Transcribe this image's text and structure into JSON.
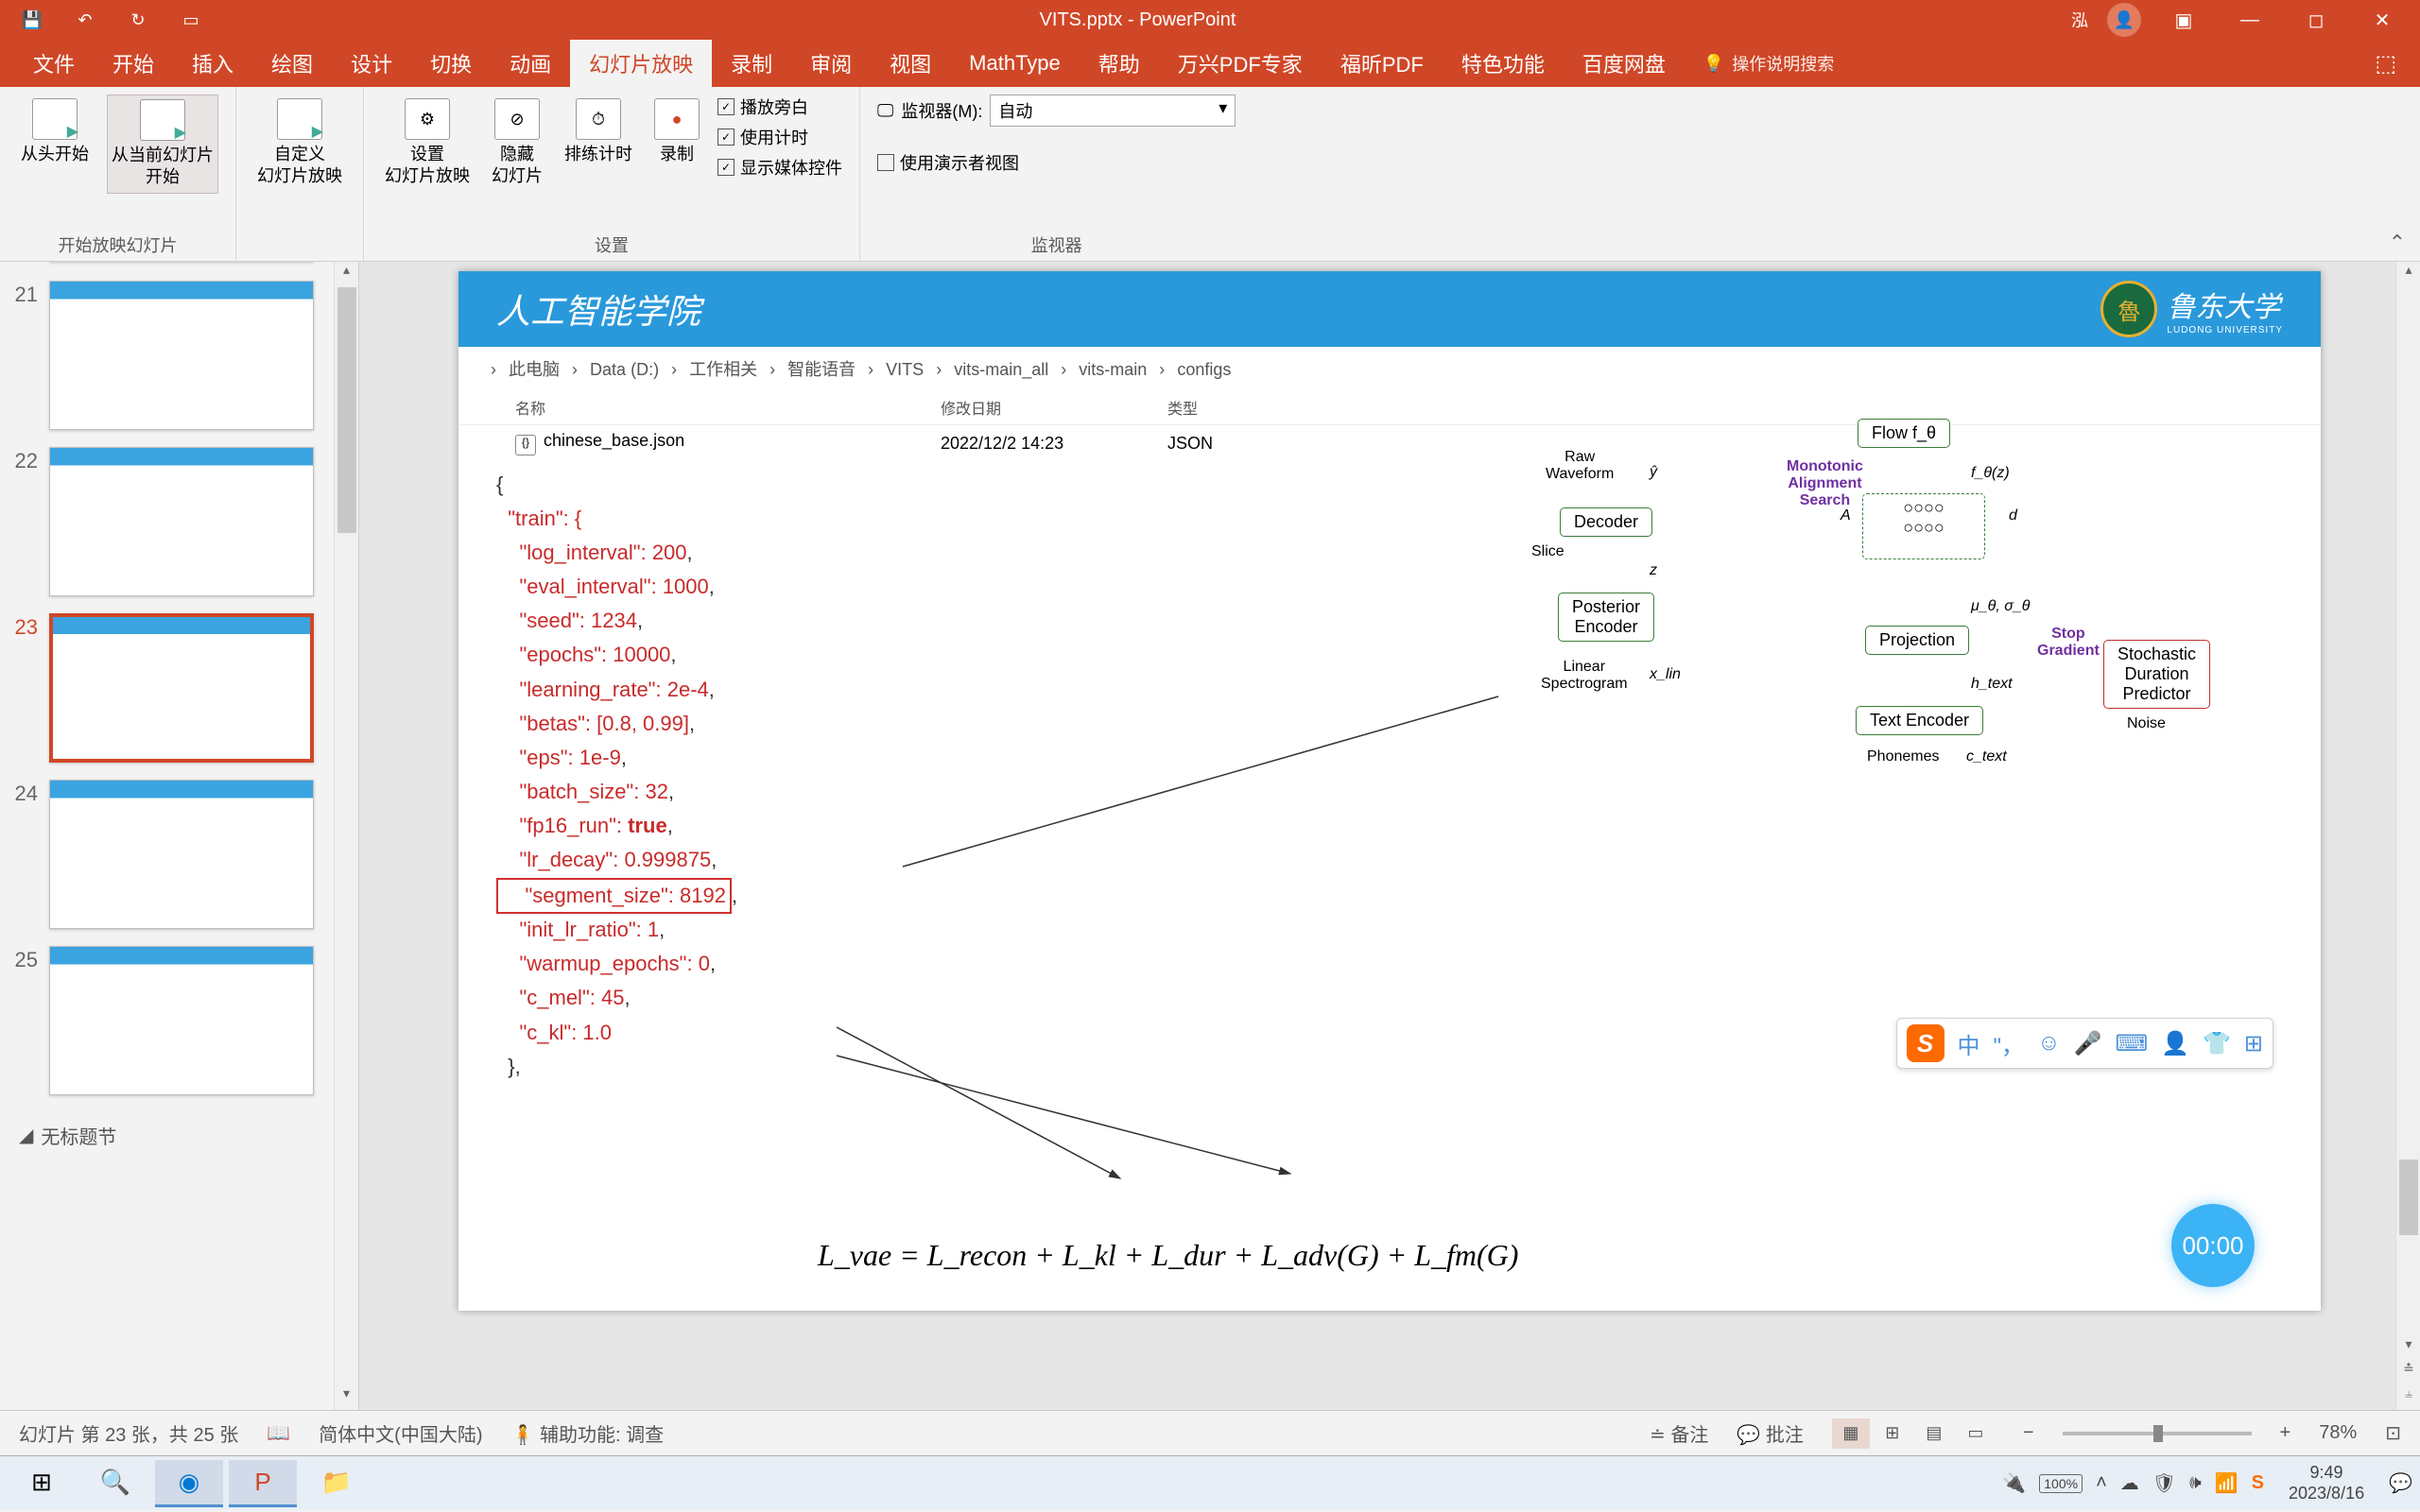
{
  "title_bar": {
    "doc_title": "VITS.pptx - PowerPoint",
    "user_name": "泓"
  },
  "ribbon_tabs": [
    "文件",
    "开始",
    "插入",
    "绘图",
    "设计",
    "切换",
    "动画",
    "幻灯片放映",
    "录制",
    "审阅",
    "视图",
    "MathType",
    "帮助",
    "万兴PDF专家",
    "福昕PDF",
    "特色功能",
    "百度网盘"
  ],
  "active_tab_index": 7,
  "tell_me_placeholder": "操作说明搜索",
  "ribbon": {
    "group1": {
      "btn1": "从头开始",
      "btn2": "从当前幻灯片\n开始",
      "label": "开始放映幻灯片"
    },
    "group1b": {
      "btn": "自定义\n幻灯片放映",
      "dropdown": "▾"
    },
    "group2": {
      "btn1": "设置\n幻灯片放映",
      "btn2": "隐藏\n幻灯片",
      "btn3": "排练计时",
      "btn4": "录制",
      "chk1": "播放旁白",
      "chk2": "使用计时",
      "chk3": "显示媒体控件",
      "label": "设置"
    },
    "group3": {
      "mon_label": "监视器(M):",
      "mon_value": "自动",
      "chk": "使用演示者视图",
      "label": "监视器"
    }
  },
  "slides": {
    "nums": [
      "21",
      "22",
      "23",
      "24",
      "25"
    ],
    "selected": 2,
    "section": "无标题节"
  },
  "slide_content": {
    "header_title": "人工智能学院",
    "uni_name": "鲁东大学",
    "uni_sub": "LUDONG UNIVERSITY",
    "breadcrumb": [
      "此电脑",
      "Data (D:)",
      "工作相关",
      "智能语音",
      "VITS",
      "vits-main_all",
      "vits-main",
      "configs"
    ],
    "table_headers": {
      "name": "名称",
      "date": "修改日期",
      "type": "类型"
    },
    "table_row": {
      "name": "chinese_base.json",
      "date": "2022/12/2 14:23",
      "type": "JSON"
    },
    "code": {
      "l0": "{",
      "l1": "  \"train\": {",
      "l2": "    \"log_interval\": ",
      "v2": "200",
      "c": ",",
      "l3": "    \"eval_interval\": ",
      "v3": "1000",
      "l4": "    \"seed\": ",
      "v4": "1234",
      "l5": "    \"epochs\": ",
      "v5": "10000",
      "l6": "    \"learning_rate\": ",
      "v6": "2e-4",
      "l7": "    \"betas\": ",
      "v7": "[0.8, 0.99]",
      "l8": "    \"eps\": ",
      "v8": "1e-9",
      "l9": "    \"batch_size\": ",
      "v9": "32",
      "l10": "    \"fp16_run\": ",
      "v10": "true",
      "l11": "    \"lr_decay\": ",
      "v11": "0.999875",
      "l12": "    \"segment_size\": ",
      "v12": "8192",
      "l13": "    \"init_lr_ratio\": ",
      "v13": "1",
      "l14": "    \"warmup_epochs\": ",
      "v14": "0",
      "l15": "    \"c_mel\": ",
      "v15": "45",
      "l16": "    \"c_kl\": ",
      "v16": "1.0",
      "l17": "  },"
    },
    "diagram": {
      "flow": "Flow   f_θ",
      "fz": "f_θ(z)",
      "mas": "Monotonic\nAlignment\nSearch",
      "decoder": "Decoder",
      "raw": "Raw\nWaveform",
      "yhat": "ŷ",
      "slice": "Slice",
      "posterior": "Posterior\nEncoder",
      "z": "z",
      "linear": "Linear\nSpectrogram",
      "xlin": "x_lin",
      "projection": "Projection",
      "mu_sigma": "μ_θ, σ_θ",
      "d": "d",
      "A": "A",
      "stop": "Stop\nGradient",
      "sdp": "Stochastic\nDuration\nPredictor",
      "noise": "Noise",
      "text_enc": "Text Encoder",
      "htext": "h_text",
      "phonemes": "Phonemes",
      "ctext": "c_text"
    },
    "formula": "L_vae = L_recon + L_kl + L_dur + L_adv(G) + L_fm(G)",
    "timer": "00:00"
  },
  "ime": {
    "lang": "中"
  },
  "status": {
    "slide_pos": "幻灯片 第 23 张，共 25 张",
    "lang": "简体中文(中国大陆)",
    "a11y": "辅助功能: 调查",
    "notes": "备注",
    "comments": "批注",
    "zoom": "78%"
  },
  "taskbar": {
    "battery": "100%",
    "time": "9:49",
    "date": "2023/8/16"
  }
}
